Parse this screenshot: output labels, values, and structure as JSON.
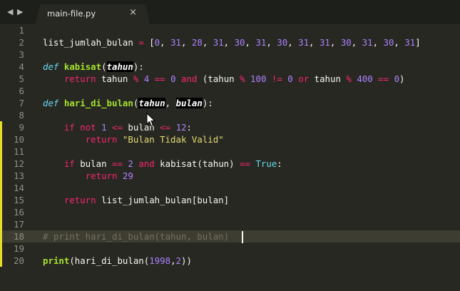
{
  "tab": {
    "title": "main-file.py",
    "close": "×"
  },
  "nav": {
    "back": "◀",
    "forward": "▶"
  },
  "lines": [
    {
      "n": "1",
      "tokens": []
    },
    {
      "n": "2",
      "tokens": [
        [
          "",
          "list_jumlah_bulan "
        ],
        [
          "op",
          "="
        ],
        [
          "",
          " ["
        ],
        [
          "num",
          "0"
        ],
        [
          "",
          ", "
        ],
        [
          "num",
          "31"
        ],
        [
          "",
          ", "
        ],
        [
          "num",
          "28"
        ],
        [
          "",
          ", "
        ],
        [
          "num",
          "31"
        ],
        [
          "",
          ", "
        ],
        [
          "num",
          "30"
        ],
        [
          "",
          ", "
        ],
        [
          "num",
          "31"
        ],
        [
          "",
          ", "
        ],
        [
          "num",
          "30"
        ],
        [
          "",
          ", "
        ],
        [
          "num",
          "31"
        ],
        [
          "",
          ", "
        ],
        [
          "num",
          "31"
        ],
        [
          "",
          ", "
        ],
        [
          "num",
          "30"
        ],
        [
          "",
          ", "
        ],
        [
          "num",
          "31"
        ],
        [
          "",
          ", "
        ],
        [
          "num",
          "30"
        ],
        [
          "",
          ", "
        ],
        [
          "num",
          "31"
        ],
        [
          "",
          "]"
        ]
      ]
    },
    {
      "n": "3",
      "tokens": []
    },
    {
      "n": "4",
      "tokens": [
        [
          "def",
          "def"
        ],
        [
          "",
          " "
        ],
        [
          "fn",
          "kabisat"
        ],
        [
          "",
          "("
        ],
        [
          "pmsel",
          "tahun"
        ],
        [
          "",
          "):"
        ]
      ]
    },
    {
      "n": "5",
      "tokens": [
        [
          "",
          "    "
        ],
        [
          "kw",
          "return"
        ],
        [
          "",
          " tahun "
        ],
        [
          "op",
          "%"
        ],
        [
          "",
          " "
        ],
        [
          "num",
          "4"
        ],
        [
          "",
          " "
        ],
        [
          "op",
          "=="
        ],
        [
          "",
          " "
        ],
        [
          "num",
          "0"
        ],
        [
          "",
          " "
        ],
        [
          "kw",
          "and"
        ],
        [
          "",
          " (tahun "
        ],
        [
          "op",
          "%"
        ],
        [
          "",
          " "
        ],
        [
          "num",
          "100"
        ],
        [
          "",
          " "
        ],
        [
          "op",
          "!="
        ],
        [
          "",
          " "
        ],
        [
          "num",
          "0"
        ],
        [
          "",
          " "
        ],
        [
          "kw",
          "or"
        ],
        [
          "",
          " tahun "
        ],
        [
          "op",
          "%"
        ],
        [
          "",
          " "
        ],
        [
          "num",
          "400"
        ],
        [
          "",
          " "
        ],
        [
          "op",
          "=="
        ],
        [
          "",
          " "
        ],
        [
          "num",
          "0"
        ],
        [
          "",
          ")"
        ]
      ]
    },
    {
      "n": "6",
      "tokens": []
    },
    {
      "n": "7",
      "tokens": [
        [
          "def",
          "def"
        ],
        [
          "",
          " "
        ],
        [
          "fn",
          "hari_di_bulan"
        ],
        [
          "",
          "("
        ],
        [
          "pmsel",
          "tahun"
        ],
        [
          "",
          ", "
        ],
        [
          "pmsel",
          "bulan"
        ],
        [
          "",
          "):"
        ]
      ]
    },
    {
      "n": "8",
      "tokens": []
    },
    {
      "n": "9",
      "tokens": [
        [
          "",
          "    "
        ],
        [
          "kw",
          "if"
        ],
        [
          "",
          " "
        ],
        [
          "kw",
          "not"
        ],
        [
          "",
          " "
        ],
        [
          "num",
          "1"
        ],
        [
          "",
          " "
        ],
        [
          "op",
          "<="
        ],
        [
          "",
          " bulan "
        ],
        [
          "op",
          "<="
        ],
        [
          "",
          " "
        ],
        [
          "num",
          "12"
        ],
        [
          "",
          ":"
        ]
      ]
    },
    {
      "n": "10",
      "tokens": [
        [
          "",
          "        "
        ],
        [
          "kw",
          "return"
        ],
        [
          "",
          " "
        ],
        [
          "str",
          "\"Bulan Tidak Valid\""
        ]
      ]
    },
    {
      "n": "11",
      "tokens": []
    },
    {
      "n": "12",
      "tokens": [
        [
          "",
          "    "
        ],
        [
          "kw",
          "if"
        ],
        [
          "",
          " bulan "
        ],
        [
          "op",
          "=="
        ],
        [
          "",
          " "
        ],
        [
          "num",
          "2"
        ],
        [
          "",
          " "
        ],
        [
          "kw",
          "and"
        ],
        [
          "",
          " kabisat(tahun) "
        ],
        [
          "op",
          "=="
        ],
        [
          "",
          " "
        ],
        [
          "bool",
          "True"
        ],
        [
          "",
          ":"
        ]
      ]
    },
    {
      "n": "13",
      "tokens": [
        [
          "",
          "        "
        ],
        [
          "kw",
          "return"
        ],
        [
          "",
          " "
        ],
        [
          "num",
          "29"
        ]
      ]
    },
    {
      "n": "14",
      "tokens": []
    },
    {
      "n": "15",
      "tokens": [
        [
          "",
          "    "
        ],
        [
          "kw",
          "return"
        ],
        [
          "",
          " list_jumlah_bulan[bulan]"
        ]
      ]
    },
    {
      "n": "16",
      "tokens": []
    },
    {
      "n": "17",
      "tokens": []
    },
    {
      "n": "18",
      "tokens": [
        [
          "cm",
          "# print hari_di_bulan(tahun, bulan)"
        ]
      ]
    },
    {
      "n": "19",
      "tokens": []
    },
    {
      "n": "20",
      "tokens": [
        [
          "fn",
          "print"
        ],
        [
          "",
          "(hari_di_bulan("
        ],
        [
          "num",
          "1998"
        ],
        [
          "",
          ","
        ],
        [
          "num",
          "2"
        ],
        [
          "",
          "))"
        ]
      ]
    }
  ],
  "modified_lines": [
    "9",
    "10",
    "11",
    "12",
    "13",
    "14",
    "15",
    "16",
    "17",
    "18",
    "19",
    "20"
  ],
  "current_line": "18",
  "colors": {
    "background": "#272822",
    "gutter_mark": "#e6db2a"
  }
}
